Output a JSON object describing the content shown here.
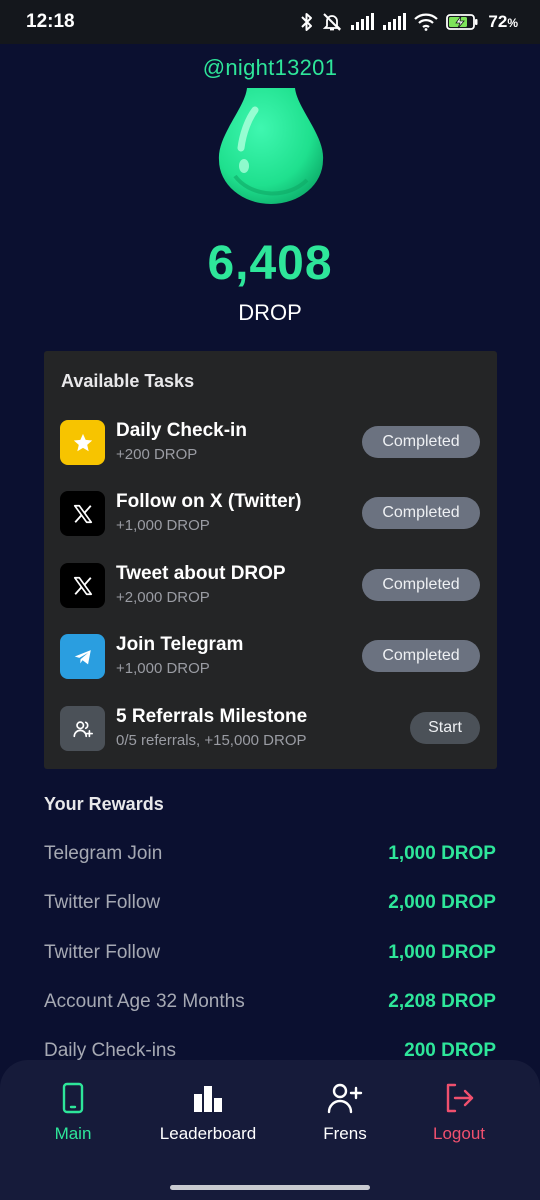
{
  "status_bar": {
    "time": "12:18",
    "battery_percent": "72",
    "battery_symbol": "%",
    "icons": [
      "bluetooth-icon",
      "mute-icon",
      "signal-icon",
      "signal-icon",
      "wifi-icon",
      "battery-charging-icon"
    ]
  },
  "profile": {
    "username": "@night13201",
    "balance": "6,408",
    "unit": "DROP"
  },
  "tasks": {
    "title": "Available Tasks",
    "items": [
      {
        "name": "Daily Check-in",
        "reward": "+200 DROP",
        "button": "Completed",
        "icon": "star-icon",
        "icon_bg": "#f7c400"
      },
      {
        "name": "Follow on X (Twitter)",
        "reward": "+1,000 DROP",
        "button": "Completed",
        "icon": "x-logo-icon",
        "icon_bg": "#000000"
      },
      {
        "name": "Tweet about DROP",
        "reward": "+2,000 DROP",
        "button": "Completed",
        "icon": "x-logo-icon",
        "icon_bg": "#000000"
      },
      {
        "name": "Join Telegram",
        "reward": "+1,000 DROP",
        "button": "Completed",
        "icon": "telegram-icon",
        "icon_bg": "#2a9ee0"
      },
      {
        "name": "5 Referrals Milestone",
        "reward": "0/5 referrals, +15,000 DROP",
        "button": "Start",
        "icon": "users-plus-icon",
        "icon_bg": "#4b5158"
      }
    ]
  },
  "rewards": {
    "title": "Your Rewards",
    "items": [
      {
        "label": "Telegram Join",
        "amount": "1,000 DROP"
      },
      {
        "label": "Twitter Follow",
        "amount": "2,000 DROP"
      },
      {
        "label": "Twitter Follow",
        "amount": "1,000 DROP"
      },
      {
        "label": "Account Age 32 Months",
        "amount": "2,208 DROP"
      },
      {
        "label": "Daily Check-ins",
        "amount": "200 DROP"
      }
    ]
  },
  "nav": {
    "items": [
      {
        "label": "Main",
        "icon": "phone-icon",
        "color": "#2ee69a"
      },
      {
        "label": "Leaderboard",
        "icon": "bar-chart-icon",
        "color": "#ffffff"
      },
      {
        "label": "Frens",
        "icon": "user-plus-icon",
        "color": "#ffffff"
      },
      {
        "label": "Logout",
        "icon": "logout-icon",
        "color": "#f0506e"
      }
    ]
  },
  "colors": {
    "accent": "#2ee69a",
    "background": "#0b1030",
    "card": "#242526",
    "logout": "#f0506e"
  }
}
